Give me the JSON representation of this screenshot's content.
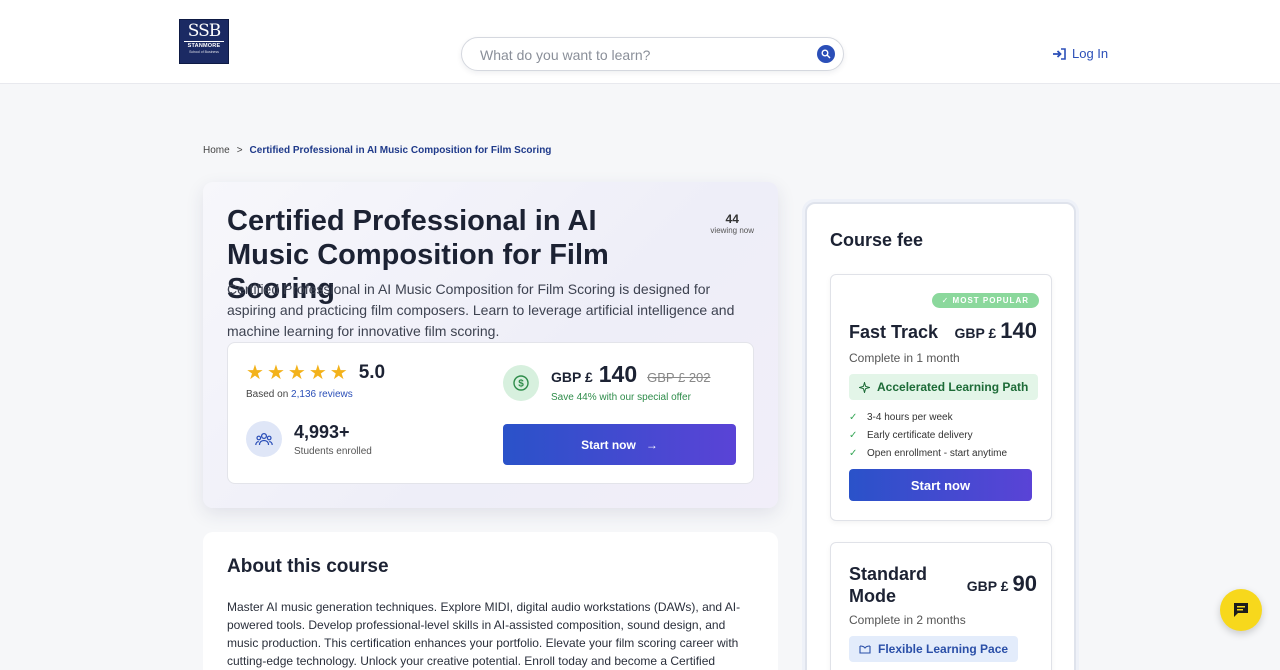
{
  "header": {
    "logo": {
      "initials": "SSB",
      "name": "STANMORE",
      "tagline": "School of Business"
    },
    "search": {
      "placeholder": "What do you want to learn?"
    },
    "login_label": "Log In"
  },
  "breadcrumb": {
    "home": "Home",
    "separator": ">",
    "current": "Certified Professional in AI Music Composition for Film Scoring"
  },
  "hero": {
    "title": "Certified Professional in AI Music Composition for Film Scoring",
    "viewing_count": "44",
    "viewing_label": "viewing now",
    "description": "Certified Professional in AI Music Composition for Film Scoring is designed for aspiring and practicing film composers. Learn to leverage artificial intelligence and machine learning for innovative film scoring.",
    "rating": "5.0",
    "stars": 5,
    "based_on": "Based on",
    "reviews_link": "2,136 reviews",
    "students": "4,993+",
    "students_label": "Students enrolled",
    "currency": "GBP £",
    "price": "140",
    "old_price": "GBP £ 202",
    "save_text": "Save 44% with our special offer",
    "start_label": "Start now",
    "arrow": "→"
  },
  "about": {
    "heading": "About this course",
    "body": "Master AI music generation techniques. Explore MIDI, digital audio workstations (DAWs), and AI-powered tools. Develop professional-level skills in AI-assisted composition, sound design, and music production. This certification enhances your portfolio. Elevate your film scoring career with cutting-edge technology. Unlock your creative potential. Enroll today and become a Certified Professional in AI Music Composition"
  },
  "fee": {
    "heading": "Course fee",
    "plans": [
      {
        "badge": "✓ MOST POPULAR",
        "name": "Fast Track",
        "currency": "GBP £",
        "price": "140",
        "complete": "Complete in 1 month",
        "pill": "Accelerated Learning Path",
        "features": [
          "3-4 hours per week",
          "Early certificate delivery",
          "Open enrollment - start anytime"
        ],
        "button": "Start now"
      },
      {
        "name": "Standard Mode",
        "currency": "GBP £",
        "price": "90",
        "complete": "Complete in 2 months",
        "pill": "Flexible Learning Pace"
      }
    ]
  },
  "colors": {
    "primary": "#2b4fb8",
    "accent_gradient_end": "#5a43d6",
    "star": "#f3b21b",
    "success": "#3aa85a",
    "chat": "#f7d81c"
  }
}
